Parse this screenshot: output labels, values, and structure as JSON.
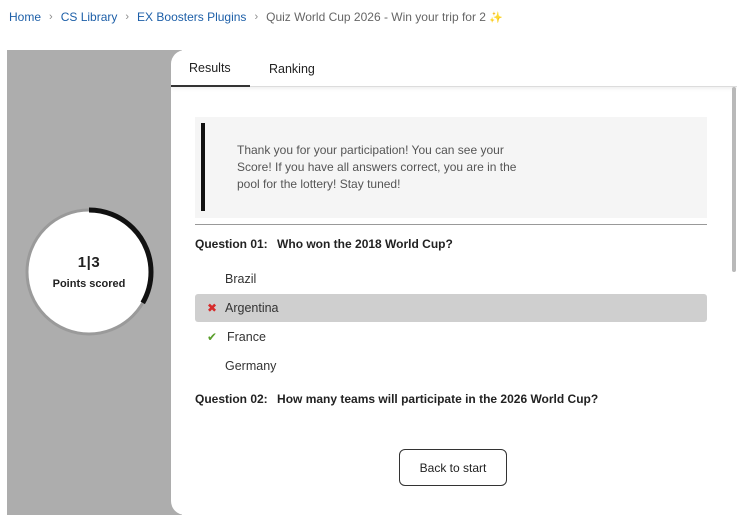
{
  "breadcrumb": {
    "items": [
      "Home",
      "CS Library",
      "EX Boosters Plugins"
    ],
    "current": "Quiz World Cup 2026 - Win your trip for 2",
    "current_icon": "sparkles-icon"
  },
  "score": {
    "value": "1|3",
    "label": "Points scored",
    "ring_progress": 0.333
  },
  "tabs": [
    {
      "label": "Results",
      "active": true
    },
    {
      "label": "Ranking",
      "active": false
    }
  ],
  "notice": {
    "text": "Thank you for your participation! You can see your Score! If you have all answers correct, you are in the pool for the lottery! Stay tuned!"
  },
  "questions": [
    {
      "number": "Question 01:",
      "text": "Who won the 2018 World Cup?",
      "answers": [
        {
          "label": "Brazil",
          "status": "none"
        },
        {
          "label": "Argentina",
          "status": "wrong"
        },
        {
          "label": "France",
          "status": "correct"
        },
        {
          "label": "Germany",
          "status": "none"
        }
      ]
    },
    {
      "number": "Question 02:",
      "text": "How many teams will participate in the 2026 World Cup?"
    }
  ],
  "back_button": {
    "label": "Back to start"
  },
  "colors": {
    "link": "#1d5fa8",
    "wrong": "#d62b2b",
    "correct": "#5a9e2b",
    "panel": "#adadad"
  }
}
